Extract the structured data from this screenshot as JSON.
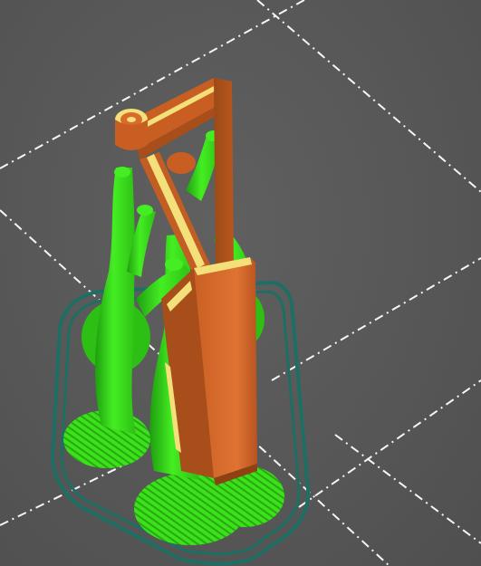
{
  "viewport": {
    "background": "#595959",
    "bed_grid_color": "#ffffff",
    "skirt_color": "#1e6f63",
    "support_color": "#3be11a",
    "support_shadow": "#1f9e10",
    "model_color": "#d96a2b",
    "model_shadow": "#a84e1b",
    "perimeter_color": "#f3e07a"
  },
  "scene": {
    "objects": [
      "bed-grid",
      "skirt-outline",
      "tree-supports",
      "sliced-model"
    ],
    "view": "isometric-preview"
  }
}
